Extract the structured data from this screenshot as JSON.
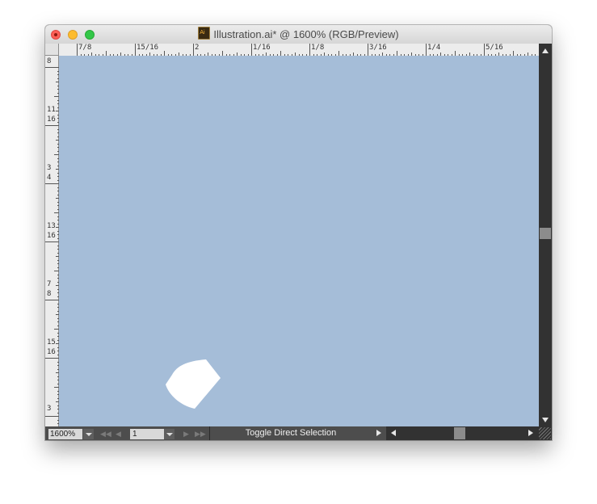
{
  "window": {
    "title": "Illustration.ai* @ 1600% (RGB/Preview)",
    "app_icon": "ai-file-icon"
  },
  "rulers": {
    "horizontal_labels": [
      "7/8",
      "15/16",
      "2",
      "1/16",
      "1/8",
      "3/16",
      "1/4",
      "5/16"
    ],
    "vertical_labels": [
      {
        "top": "",
        "bottom": "8"
      },
      {
        "top": "11",
        "bottom": "16"
      },
      {
        "top": "3",
        "bottom": "4"
      },
      {
        "top": "13",
        "bottom": "16"
      },
      {
        "top": "7",
        "bottom": "8"
      },
      {
        "top": "15",
        "bottom": "16"
      },
      {
        "top": "3",
        "bottom": ""
      }
    ]
  },
  "status_bar": {
    "zoom_value": "1600%",
    "page_value": "1",
    "status_text": "Toggle Direct Selection"
  },
  "colors": {
    "canvas": "#a5bdd8",
    "shape_fill": "#ffffff",
    "chrome_dark": "#323232"
  },
  "icons": {
    "first": "first-page-icon",
    "prev": "previous-page-icon",
    "next": "next-page-icon",
    "last": "last-page-icon"
  }
}
